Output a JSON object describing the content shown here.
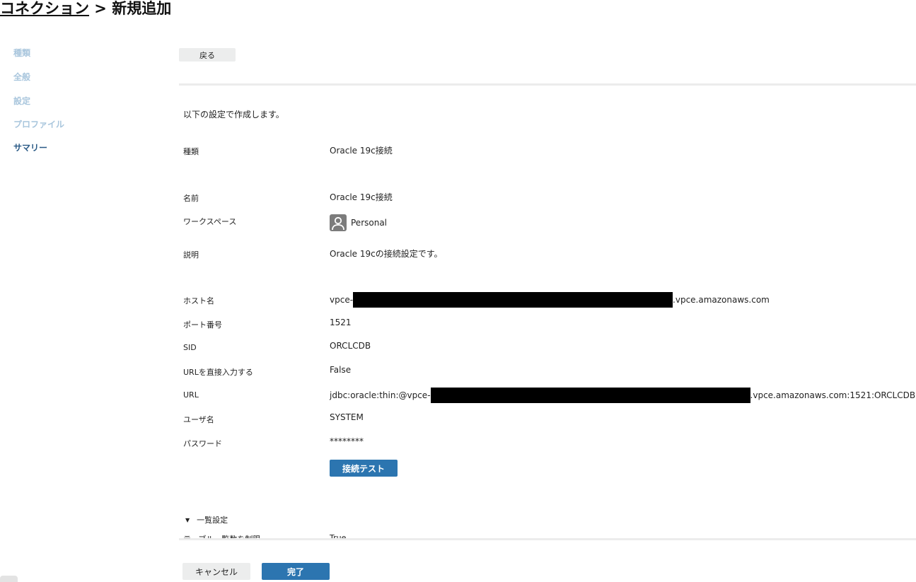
{
  "header": {
    "crumb_link": "コネクション",
    "separator": " > ",
    "current": "新規追加"
  },
  "sidebar": {
    "items": [
      {
        "label": "種類"
      },
      {
        "label": "全般"
      },
      {
        "label": "設定"
      },
      {
        "label": "プロファイル"
      },
      {
        "label": "サマリー"
      }
    ],
    "active_index": 4
  },
  "toolbar": {
    "back_label": "戻る"
  },
  "summary": {
    "intro": "以下の設定で作成します。",
    "rows": [
      {
        "label": "種類",
        "value": "Oracle 19c接続"
      },
      {
        "label": "名前",
        "value": "Oracle 19c接続"
      },
      {
        "label": "ワークスペース",
        "value": "Personal",
        "icon": "user-avatar-icon"
      },
      {
        "label": "説明",
        "value": "Oracle 19cの接続設定です。"
      },
      {
        "label": "ホスト名",
        "value_prefix": "vpce-",
        "value_suffix": ".vpce.amazonaws.com",
        "redacted": true
      },
      {
        "label": "ポート番号",
        "value": "1521"
      },
      {
        "label": "SID",
        "value": "ORCLCDB"
      },
      {
        "label": "URLを直接入力する",
        "value": "False"
      },
      {
        "label": "URL",
        "value_prefix": "jdbc:oracle:thin:@vpce-",
        "value_suffix": ".vpce.amazonaws.com:1521:ORCLCDB",
        "redacted": true
      },
      {
        "label": "ユーザ名",
        "value": "SYSTEM"
      },
      {
        "label": "パスワード",
        "value": "********"
      }
    ],
    "test_button_label": "接続テスト"
  },
  "list_settings": {
    "toggle_label": "一覧設定",
    "cut_row_label": "テーブル一覧数を制限",
    "cut_row_value": "True"
  },
  "footer": {
    "cancel_label": "キャンセル",
    "finish_label": "完了"
  },
  "colors": {
    "primary": "#2c75b0",
    "sidebar_active": "#2a5a86",
    "sidebar_inactive": "#a9c6dd",
    "secondary_button": "#eceded"
  }
}
